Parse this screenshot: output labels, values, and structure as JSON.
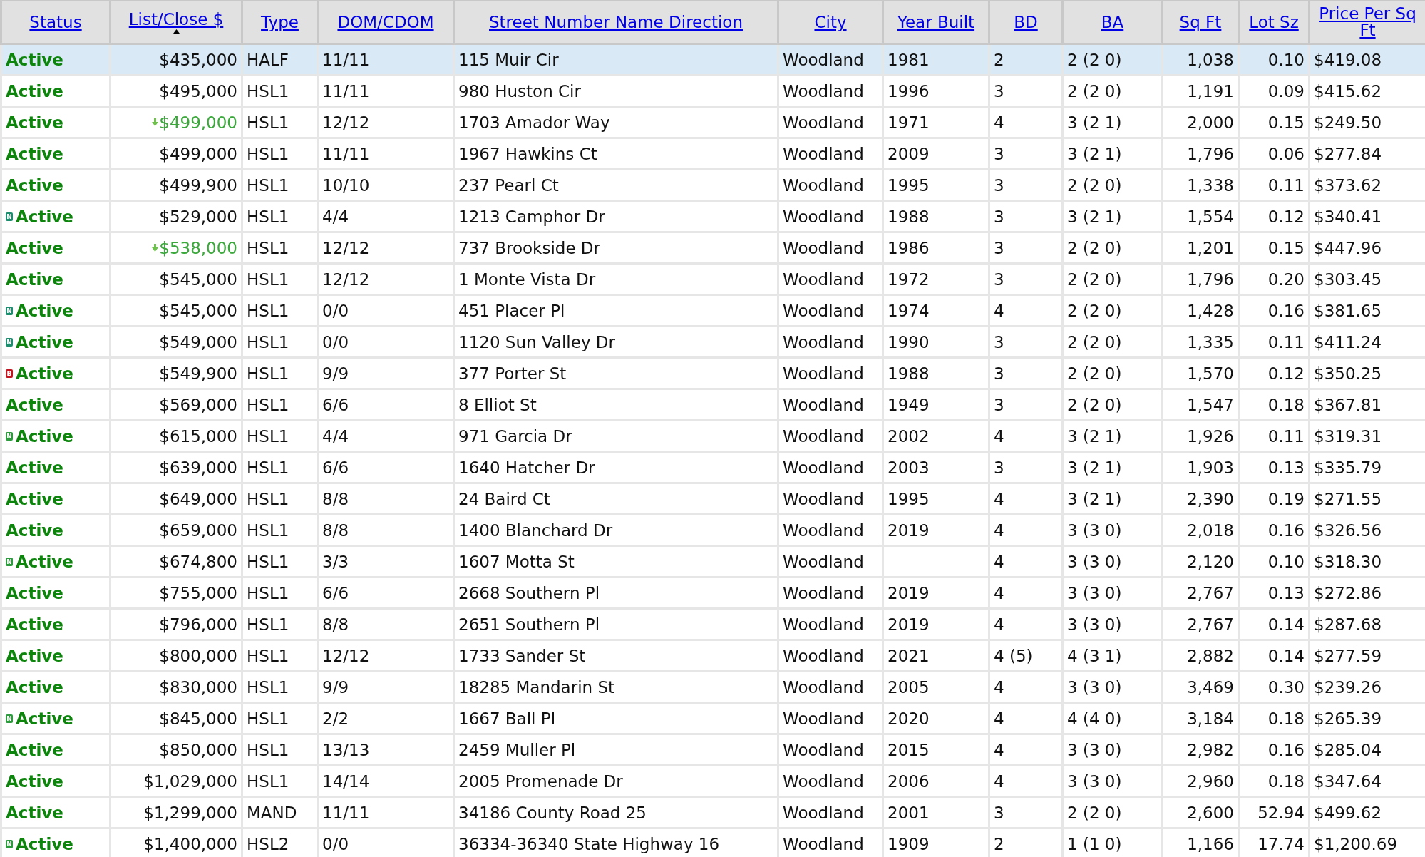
{
  "table": {
    "columns": [
      {
        "label": "Status",
        "sorted": false
      },
      {
        "label": "List/Close $",
        "sorted": true
      },
      {
        "label": "Type",
        "sorted": false
      },
      {
        "label": "DOM/CDOM",
        "sorted": false
      },
      {
        "label": "Street Number Name Direction",
        "sorted": false
      },
      {
        "label": "City",
        "sorted": false
      },
      {
        "label": "Year Built",
        "sorted": false
      },
      {
        "label": "BD",
        "sorted": false
      },
      {
        "label": "BA",
        "sorted": false
      },
      {
        "label": "Sq Ft",
        "sorted": false
      },
      {
        "label": "Lot Sz",
        "sorted": false
      },
      {
        "label": "Price Per Sq Ft",
        "sorted": false
      }
    ],
    "rows": [
      {
        "selected": true,
        "status": "Active",
        "price": "$435,000",
        "price_reduced": false,
        "type": "HALF",
        "dom": "11/11",
        "address": "115 Muir Cir",
        "city": "Woodland",
        "year": "1981",
        "bd": "2",
        "ba": "2 (2 0)",
        "sqft": "1,038",
        "lot": "0.10",
        "ppsf": "$419.08"
      },
      {
        "selected": false,
        "status": "Active",
        "price": "$495,000",
        "price_reduced": false,
        "type": "HSL1",
        "dom": "11/11",
        "address": "980 Huston Cir",
        "city": "Woodland",
        "year": "1996",
        "bd": "3",
        "ba": "2 (2 0)",
        "sqft": "1,191",
        "lot": "0.09",
        "ppsf": "$415.62"
      },
      {
        "selected": false,
        "status": "Active",
        "price": "$499,000",
        "price_reduced": true,
        "type": "HSL1",
        "dom": "12/12",
        "address": "1703 Amador Way",
        "city": "Woodland",
        "year": "1971",
        "bd": "4",
        "ba": "3 (2 1)",
        "sqft": "2,000",
        "lot": "0.15",
        "ppsf": "$249.50"
      },
      {
        "selected": false,
        "status": "Active",
        "price": "$499,000",
        "price_reduced": false,
        "type": "HSL1",
        "dom": "11/11",
        "address": "1967 Hawkins Ct",
        "city": "Woodland",
        "year": "2009",
        "bd": "3",
        "ba": "3 (2 1)",
        "sqft": "1,796",
        "lot": "0.06",
        "ppsf": "$277.84"
      },
      {
        "selected": false,
        "status": "Active",
        "price": "$499,900",
        "price_reduced": false,
        "type": "HSL1",
        "dom": "10/10",
        "address": "237 Pearl Ct",
        "city": "Woodland",
        "year": "1995",
        "bd": "3",
        "ba": "2 (2 0)",
        "sqft": "1,338",
        "lot": "0.11",
        "ppsf": "$373.62"
      },
      {
        "selected": false,
        "badge": {
          "letter": "N",
          "color": "#1e8c6e"
        },
        "status": "Active",
        "price": "$529,000",
        "price_reduced": false,
        "type": "HSL1",
        "dom": "4/4",
        "address": "1213 Camphor Dr",
        "city": "Woodland",
        "year": "1988",
        "bd": "3",
        "ba": "3 (2 1)",
        "sqft": "1,554",
        "lot": "0.12",
        "ppsf": "$340.41"
      },
      {
        "selected": false,
        "status": "Active",
        "price": "$538,000",
        "price_reduced": true,
        "type": "HSL1",
        "dom": "12/12",
        "address": "737 Brookside Dr",
        "city": "Woodland",
        "year": "1986",
        "bd": "3",
        "ba": "2 (2 0)",
        "sqft": "1,201",
        "lot": "0.15",
        "ppsf": "$447.96"
      },
      {
        "selected": false,
        "status": "Active",
        "price": "$545,000",
        "price_reduced": false,
        "type": "HSL1",
        "dom": "12/12",
        "address": "1 Monte Vista Dr",
        "city": "Woodland",
        "year": "1972",
        "bd": "3",
        "ba": "2 (2 0)",
        "sqft": "1,796",
        "lot": "0.20",
        "ppsf": "$303.45"
      },
      {
        "selected": false,
        "badge": {
          "letter": "N",
          "color": "#1e8c6e"
        },
        "status": "Active",
        "price": "$545,000",
        "price_reduced": false,
        "type": "HSL1",
        "dom": "0/0",
        "address": "451 Placer Pl",
        "city": "Woodland",
        "year": "1974",
        "bd": "4",
        "ba": "2 (2 0)",
        "sqft": "1,428",
        "lot": "0.16",
        "ppsf": "$381.65"
      },
      {
        "selected": false,
        "badge": {
          "letter": "N",
          "color": "#1e8c6e"
        },
        "status": "Active",
        "price": "$549,000",
        "price_reduced": false,
        "type": "HSL1",
        "dom": "0/0",
        "address": "1120 Sun Valley Dr",
        "city": "Woodland",
        "year": "1990",
        "bd": "3",
        "ba": "2 (2 0)",
        "sqft": "1,335",
        "lot": "0.11",
        "ppsf": "$411.24"
      },
      {
        "selected": false,
        "badge": {
          "letter": "B",
          "color": "#c0141e"
        },
        "status": "Active",
        "price": "$549,900",
        "price_reduced": false,
        "type": "HSL1",
        "dom": "9/9",
        "address": "377 Porter St",
        "city": "Woodland",
        "year": "1988",
        "bd": "3",
        "ba": "2 (2 0)",
        "sqft": "1,570",
        "lot": "0.12",
        "ppsf": "$350.25"
      },
      {
        "selected": false,
        "status": "Active",
        "price": "$569,000",
        "price_reduced": false,
        "type": "HSL1",
        "dom": "6/6",
        "address": "8 Elliot St",
        "city": "Woodland",
        "year": "1949",
        "bd": "3",
        "ba": "2 (2 0)",
        "sqft": "1,547",
        "lot": "0.18",
        "ppsf": "$367.81"
      },
      {
        "selected": false,
        "badge": {
          "letter": "N",
          "color": "#2e9a3e"
        },
        "status": "Active",
        "price": "$615,000",
        "price_reduced": false,
        "type": "HSL1",
        "dom": "4/4",
        "address": "971 Garcia Dr",
        "city": "Woodland",
        "year": "2002",
        "bd": "4",
        "ba": "3 (2 1)",
        "sqft": "1,926",
        "lot": "0.11",
        "ppsf": "$319.31"
      },
      {
        "selected": false,
        "status": "Active",
        "price": "$639,000",
        "price_reduced": false,
        "type": "HSL1",
        "dom": "6/6",
        "address": "1640 Hatcher Dr",
        "city": "Woodland",
        "year": "2003",
        "bd": "3",
        "ba": "3 (2 1)",
        "sqft": "1,903",
        "lot": "0.13",
        "ppsf": "$335.79"
      },
      {
        "selected": false,
        "status": "Active",
        "price": "$649,000",
        "price_reduced": false,
        "type": "HSL1",
        "dom": "8/8",
        "address": "24 Baird Ct",
        "city": "Woodland",
        "year": "1995",
        "bd": "4",
        "ba": "3 (2 1)",
        "sqft": "2,390",
        "lot": "0.19",
        "ppsf": "$271.55"
      },
      {
        "selected": false,
        "status": "Active",
        "price": "$659,000",
        "price_reduced": false,
        "type": "HSL1",
        "dom": "8/8",
        "address": "1400 Blanchard Dr",
        "city": "Woodland",
        "year": "2019",
        "bd": "4",
        "ba": "3 (3 0)",
        "sqft": "2,018",
        "lot": "0.16",
        "ppsf": "$326.56"
      },
      {
        "selected": false,
        "badge": {
          "letter": "N",
          "color": "#2e9a3e"
        },
        "status": "Active",
        "price": "$674,800",
        "price_reduced": false,
        "type": "HSL1",
        "dom": "3/3",
        "address": "1607 Motta St",
        "city": "Woodland",
        "bd": "4",
        "ba": "3 (3 0)",
        "sqft": "2,120",
        "lot": "0.10",
        "ppsf": "$318.30"
      },
      {
        "selected": false,
        "status": "Active",
        "price": "$755,000",
        "price_reduced": false,
        "type": "HSL1",
        "dom": "6/6",
        "address": "2668 Southern Pl",
        "city": "Woodland",
        "year": "2019",
        "bd": "4",
        "ba": "3 (3 0)",
        "sqft": "2,767",
        "lot": "0.13",
        "ppsf": "$272.86"
      },
      {
        "selected": false,
        "status": "Active",
        "price": "$796,000",
        "price_reduced": false,
        "type": "HSL1",
        "dom": "8/8",
        "address": "2651 Southern Pl",
        "city": "Woodland",
        "year": "2019",
        "bd": "4",
        "ba": "3 (3 0)",
        "sqft": "2,767",
        "lot": "0.14",
        "ppsf": "$287.68"
      },
      {
        "selected": false,
        "status": "Active",
        "price": "$800,000",
        "price_reduced": false,
        "type": "HSL1",
        "dom": "12/12",
        "address": "1733 Sander St",
        "city": "Woodland",
        "year": "2021",
        "bd": "4 (5)",
        "ba": "4 (3 1)",
        "sqft": "2,882",
        "lot": "0.14",
        "ppsf": "$277.59"
      },
      {
        "selected": false,
        "status": "Active",
        "price": "$830,000",
        "price_reduced": false,
        "type": "HSL1",
        "dom": "9/9",
        "address": "18285 Mandarin St",
        "city": "Woodland",
        "year": "2005",
        "bd": "4",
        "ba": "3 (3 0)",
        "sqft": "3,469",
        "lot": "0.30",
        "ppsf": "$239.26"
      },
      {
        "selected": false,
        "badge": {
          "letter": "N",
          "color": "#2e9a3e"
        },
        "status": "Active",
        "price": "$845,000",
        "price_reduced": false,
        "type": "HSL1",
        "dom": "2/2",
        "address": "1667 Ball Pl",
        "city": "Woodland",
        "year": "2020",
        "bd": "4",
        "ba": "4 (4 0)",
        "sqft": "3,184",
        "lot": "0.18",
        "ppsf": "$265.39"
      },
      {
        "selected": false,
        "status": "Active",
        "price": "$850,000",
        "price_reduced": false,
        "type": "HSL1",
        "dom": "13/13",
        "address": "2459 Muller Pl",
        "city": "Woodland",
        "year": "2015",
        "bd": "4",
        "ba": "3 (3 0)",
        "sqft": "2,982",
        "lot": "0.16",
        "ppsf": "$285.04"
      },
      {
        "selected": false,
        "status": "Active",
        "price": "$1,029,000",
        "price_reduced": false,
        "type": "HSL1",
        "dom": "14/14",
        "address": "2005 Promenade Dr",
        "city": "Woodland",
        "year": "2006",
        "bd": "4",
        "ba": "3 (3 0)",
        "sqft": "2,960",
        "lot": "0.18",
        "ppsf": "$347.64"
      },
      {
        "selected": false,
        "status": "Active",
        "price": "$1,299,000",
        "price_reduced": false,
        "type": "MAND",
        "dom": "11/11",
        "address": "34186 County Road 25",
        "city": "Woodland",
        "year": "2001",
        "bd": "3",
        "ba": "2 (2 0)",
        "sqft": "2,600",
        "lot": "52.94",
        "ppsf": "$499.62"
      },
      {
        "selected": false,
        "badge": {
          "letter": "N",
          "color": "#2e9a3e"
        },
        "status": "Active",
        "price": "$1,400,000",
        "price_reduced": false,
        "type": "HSL2",
        "dom": "0/0",
        "address": "36334-36340 State Highway 16",
        "city": "Woodland",
        "year": "1909",
        "bd": "2",
        "ba": "1 (1 0)",
        "sqft": "1,166",
        "lot": "17.74",
        "ppsf": "$1,200.69"
      }
    ]
  }
}
